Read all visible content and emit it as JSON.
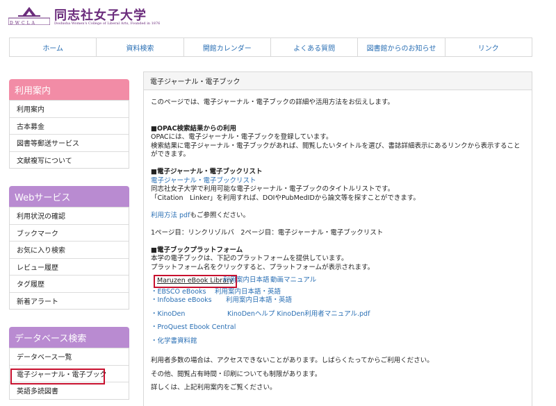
{
  "header": {
    "logo_letters": "DWCLA",
    "title": "同志社女子大学",
    "subtitle": "Doshisha Women's College of Liberal Arts, Founded in 1876"
  },
  "topnav": [
    "ホーム",
    "資料検索",
    "開館カレンダー",
    "よくある質問",
    "図書館からのお知らせ",
    "リンク"
  ],
  "sidebar": {
    "guide": {
      "title": "利用案内",
      "items": [
        "利用案内",
        "古本募金",
        "図書等郵送サービス",
        "文献複写について"
      ]
    },
    "web": {
      "title": "Webサービス",
      "items": [
        "利用状況の確認",
        "ブックマーク",
        "お気に入り検索",
        "レビュー履歴",
        "タグ履歴",
        "新着アラート"
      ]
    },
    "db": {
      "title": "データベース検索",
      "items": [
        "データベース一覧",
        "電子ジャーナル・電子ブック",
        "英語多読図書"
      ]
    }
  },
  "main": {
    "title": "電子ジャーナル・電子ブック",
    "intro": "このページでは、電子ジャーナル・電子ブックの詳細や活用方法をお伝えします。",
    "opac": {
      "heading": "■OPAC検索結果からの利用",
      "line1": "OPACには、電子ジャーナル・電子ブックを登録しています。",
      "line2": "検索結果に電子ジャーナル・電子ブックがあれば、閲覧したいタイトルを選び、書誌詳細表示にあるリンクから表示することができます。"
    },
    "list": {
      "heading": "■電子ジャーナル・電子ブックリスト",
      "link": "電子ジャーナル・電子ブックリスト",
      "line1": "同志社女子大学で利用可能な電子ジャーナル・電子ブックのタイトルリストです。",
      "line2": "「Citation　Linker」を利用すれば、DOIやPubMedIDから論文等を探すことができます。",
      "pdf_link": "利用方法 pdf",
      "pdf_suffix": "もご参照ください。",
      "pages": "1ページ目：リンクリゾルバ　2ページ目：電子ジャーナル・電子ブックリスト"
    },
    "platform": {
      "heading": "■電子ブックプラットフォーム",
      "line1": "本学の電子ブックは、下記のプラットフォームを提供しています。",
      "line2": "プラットフォーム名をクリックすると、プラットフォームが表示されます。",
      "maruzen": "Maruzen eBook Library",
      "maruzen_guide": "利用案内日本語",
      "maruzen_video": "動画マニュアル",
      "ebsco": "・EBSCO eBooks",
      "ebsco_guide": "利用案内日本語・英語",
      "infobase": "・Infobase eBooks",
      "infobase_guide": "利用案内日本語・英語",
      "kinoden": "・KinoDen",
      "kinoden_help": "KinoDenヘルプ KinoDen利用者マニュアル.pdf",
      "proquest": "・ProQuest Ebook Central",
      "kagaku": "・化学書資料館"
    },
    "notes": {
      "line1": "利用者多数の場合は、アクセスできないことがあります。しばらくたってからご利用ください。",
      "line2": "その他、閲覧占有時間・印刷についても制限があります。",
      "line3": "詳しくは、上記利用案内をご覧ください。"
    }
  },
  "colors": {
    "accent_purple": "#6b2c7c",
    "link": "#2a6fb4",
    "pink_header": "#f28ca6",
    "purple_header": "#b98bd1",
    "highlight_red": "#c8102e"
  }
}
